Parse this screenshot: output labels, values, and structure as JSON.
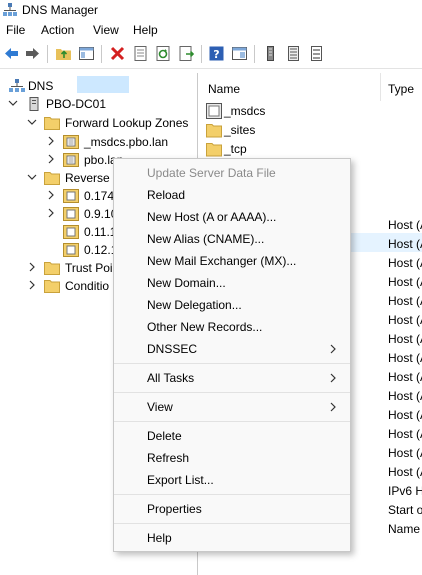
{
  "window": {
    "title": "DNS Manager"
  },
  "menu": [
    "File",
    "Action",
    "View",
    "Help"
  ],
  "toolbar": {
    "icons": [
      "back-icon",
      "forward-icon",
      "up-folder-icon",
      "show-hide-tree-icon",
      "delete-icon",
      "properties-icon",
      "refresh-icon",
      "export-list-icon",
      "help-icon",
      "mmc-panel-icon",
      "filter-icon",
      "list-icon",
      "detail-icon"
    ]
  },
  "tree": {
    "root": "DNS",
    "server": "PBO-DC01",
    "forward_zones": "Forward Lookup Zones",
    "zone_msdcs": "_msdcs.pbo.lan",
    "zone_pbo": "pbo.lan",
    "reverse_zones": "Reverse L",
    "rev1": "0.174",
    "rev2": "0.9.10",
    "rev3": "0.11.1",
    "rev4": "0.12.1",
    "trust_points": "Trust Poi",
    "conditional": "Conditio"
  },
  "list": {
    "col_name": "Name",
    "col_type": "Type",
    "folders": [
      "_msdcs",
      "_sites",
      "_tcp"
    ],
    "types": [
      "Host (A",
      "Host (A",
      "Host (A",
      "Host (A",
      "Host (A",
      "Host (A",
      "Host (A",
      "Host (A",
      "Host (A",
      "Host (A",
      "Host (A",
      "Host (A",
      "Host (A",
      "Host (A",
      "IPv6 H",
      "Start o",
      "Name"
    ]
  },
  "context_menu": {
    "update": "Update Server Data File",
    "reload": "Reload",
    "new_host": "New Host (A or AAAA)...",
    "new_alias": "New Alias (CNAME)...",
    "new_mx": "New Mail Exchanger (MX)...",
    "new_domain": "New Domain...",
    "new_delegation": "New Delegation...",
    "other_records": "Other New Records...",
    "dnssec": "DNSSEC",
    "all_tasks": "All Tasks",
    "view": "View",
    "delete": "Delete",
    "refresh": "Refresh",
    "export": "Export List...",
    "properties": "Properties",
    "help": "Help"
  }
}
